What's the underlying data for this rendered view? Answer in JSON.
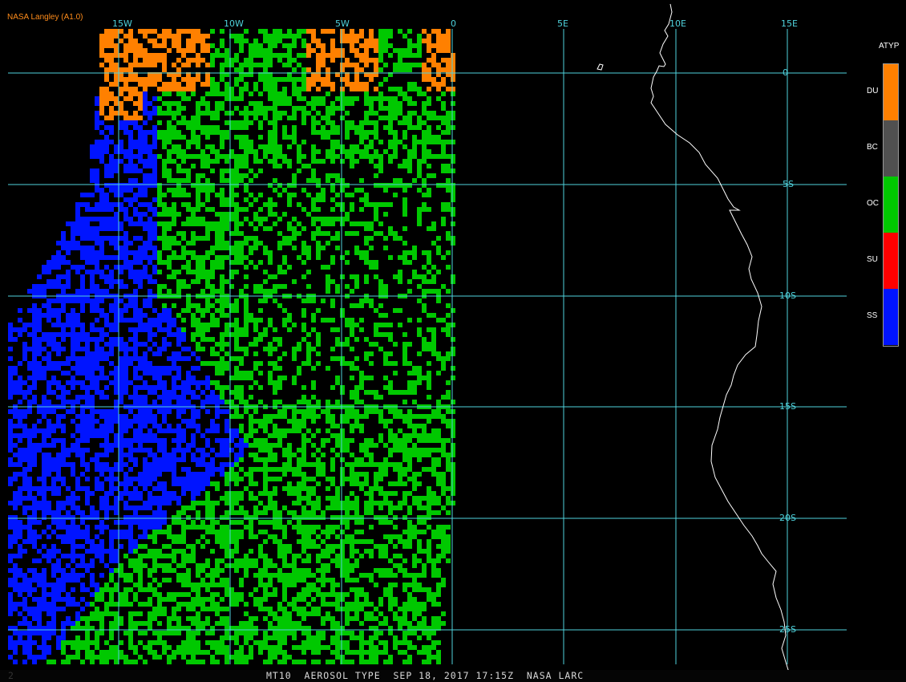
{
  "credit": "NASA Langley (A1.0)",
  "footer": {
    "text": "MT10  AEROSOL TYPE  SEP 18, 2017 17:15Z  NASA LARC",
    "corner": "2"
  },
  "grid": {
    "lon_labels": [
      "15W",
      "10W",
      "5W",
      "0",
      "5E",
      "10E",
      "15E"
    ],
    "lat_labels": [
      "0",
      "5S",
      "10S",
      "15S",
      "20S",
      "25S"
    ]
  },
  "legend": {
    "title": "ATYP",
    "items": [
      {
        "label": "DU",
        "color": "#ff8000"
      },
      {
        "label": "BC",
        "color": "#505050"
      },
      {
        "label": "OC",
        "color": "#00c800"
      },
      {
        "label": "SU",
        "color": "#ff0000"
      },
      {
        "label": "SS",
        "color": "#0014ff"
      }
    ]
  },
  "colors": {
    "grid": "#4fd2dc",
    "coast": "#ffffff",
    "background": "#000000"
  }
}
